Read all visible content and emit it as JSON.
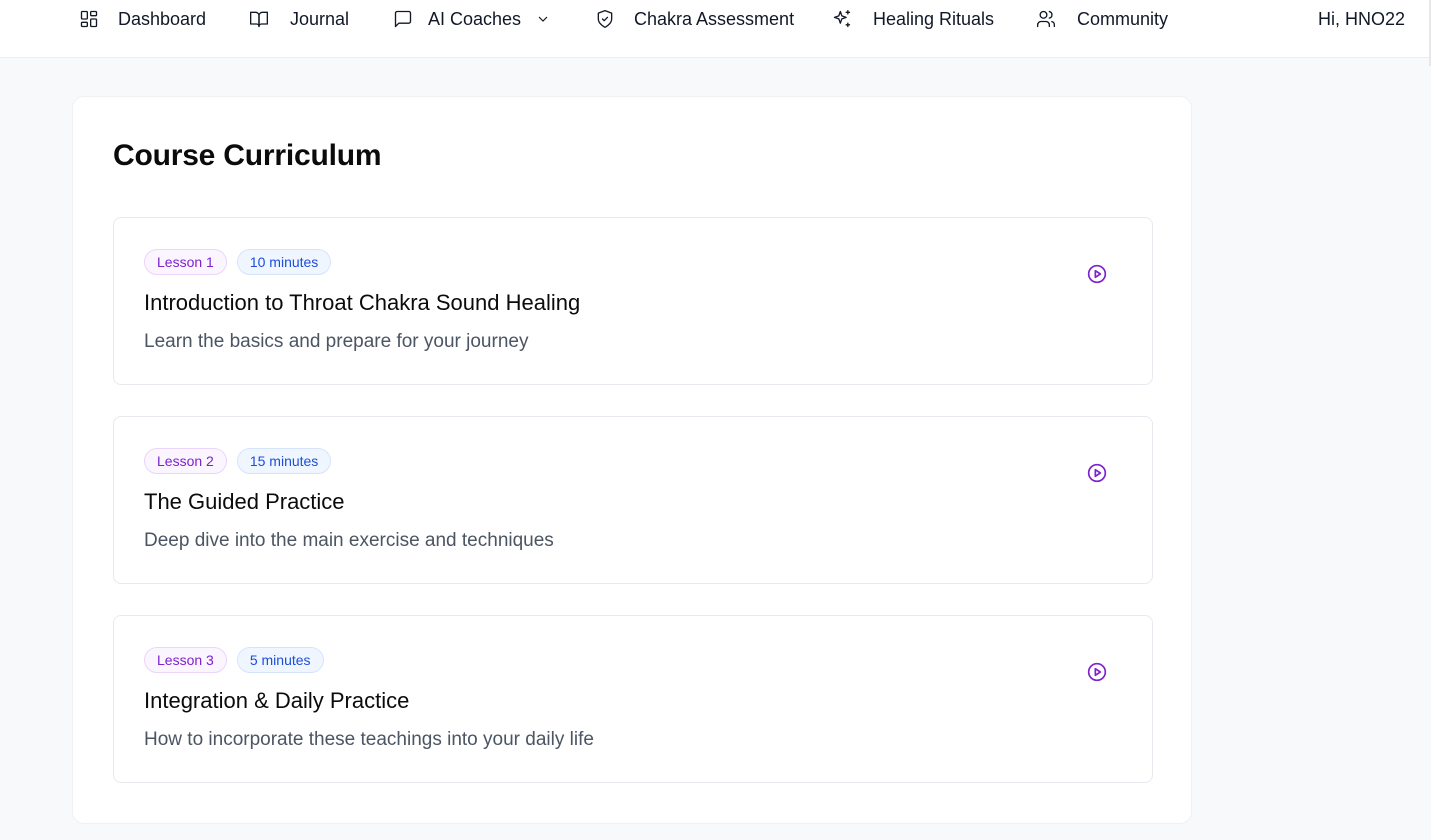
{
  "nav": {
    "items": [
      {
        "label": "Dashboard",
        "icon": "dashboard-grid-icon"
      },
      {
        "label": "Journal",
        "icon": "book-icon"
      },
      {
        "label": "AI Coaches",
        "icon": "message-square-icon"
      },
      {
        "label": "Chakra Assessment",
        "icon": "shield-check-icon"
      },
      {
        "label": "Healing Rituals",
        "icon": "sparkles-icon"
      },
      {
        "label": "Community",
        "icon": "users-icon"
      }
    ],
    "greeting": "Hi, HNO22"
  },
  "curriculum": {
    "title": "Course Curriculum",
    "lessons": [
      {
        "badge": "Lesson 1",
        "duration": "10 minutes",
        "title": "Introduction to Throat Chakra Sound Healing",
        "description": "Learn the basics and prepare for your journey"
      },
      {
        "badge": "Lesson 2",
        "duration": "15 minutes",
        "title": "The Guided Practice",
        "description": "Deep dive into the main exercise and techniques"
      },
      {
        "badge": "Lesson 3",
        "duration": "5 minutes",
        "title": "Integration & Daily Practice",
        "description": "How to incorporate these teachings into your daily life"
      }
    ]
  },
  "colors": {
    "accent_purple": "#7e22ce",
    "accent_blue": "#1d4ed8",
    "play_icon": "#7e22ce"
  }
}
